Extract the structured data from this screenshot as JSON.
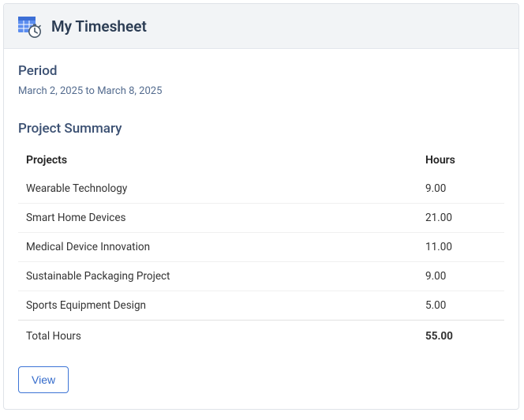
{
  "header": {
    "title": "My Timesheet"
  },
  "period": {
    "label": "Period",
    "value": "March 2, 2025 to March 8, 2025"
  },
  "summary": {
    "title": "Project Summary",
    "columns": {
      "project": "Projects",
      "hours": "Hours"
    },
    "rows": [
      {
        "project": "Wearable Technology",
        "hours": "9.00"
      },
      {
        "project": "Smart Home Devices",
        "hours": "21.00"
      },
      {
        "project": "Medical Device Innovation",
        "hours": "11.00"
      },
      {
        "project": "Sustainable Packaging Project",
        "hours": "9.00"
      },
      {
        "project": "Sports Equipment Design",
        "hours": "5.00"
      }
    ],
    "total": {
      "label": "Total Hours",
      "hours": "55.00"
    }
  },
  "actions": {
    "view": "View"
  }
}
